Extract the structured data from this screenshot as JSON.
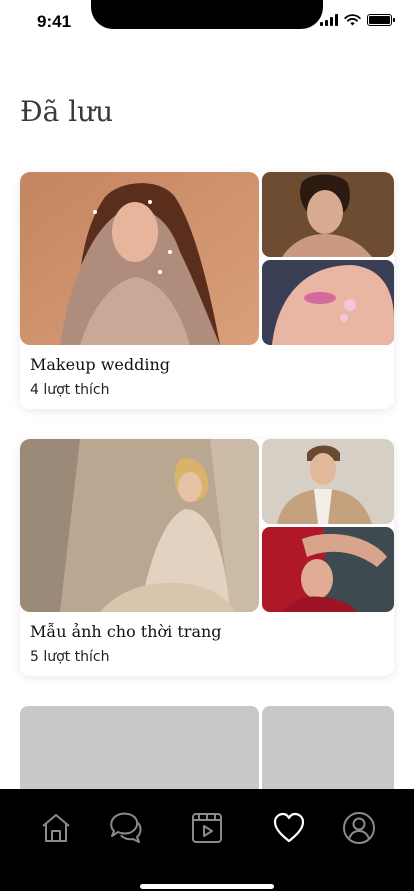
{
  "status_bar": {
    "time": "9:41"
  },
  "page": {
    "title": "Đã lưu"
  },
  "collections": [
    {
      "title": "Makeup wedding",
      "likes": "4 lượt thích"
    },
    {
      "title": "Mẫu ảnh cho thời trang",
      "likes": "5 lượt thích"
    }
  ],
  "nav": {
    "items": [
      "home-icon",
      "chat-icon",
      "video-icon",
      "heart-icon",
      "profile-icon"
    ],
    "active": "heart-icon"
  },
  "colors": {
    "nav_background": "#000000",
    "placeholder": "#c8c8c8",
    "title": "#3a3a3a"
  }
}
